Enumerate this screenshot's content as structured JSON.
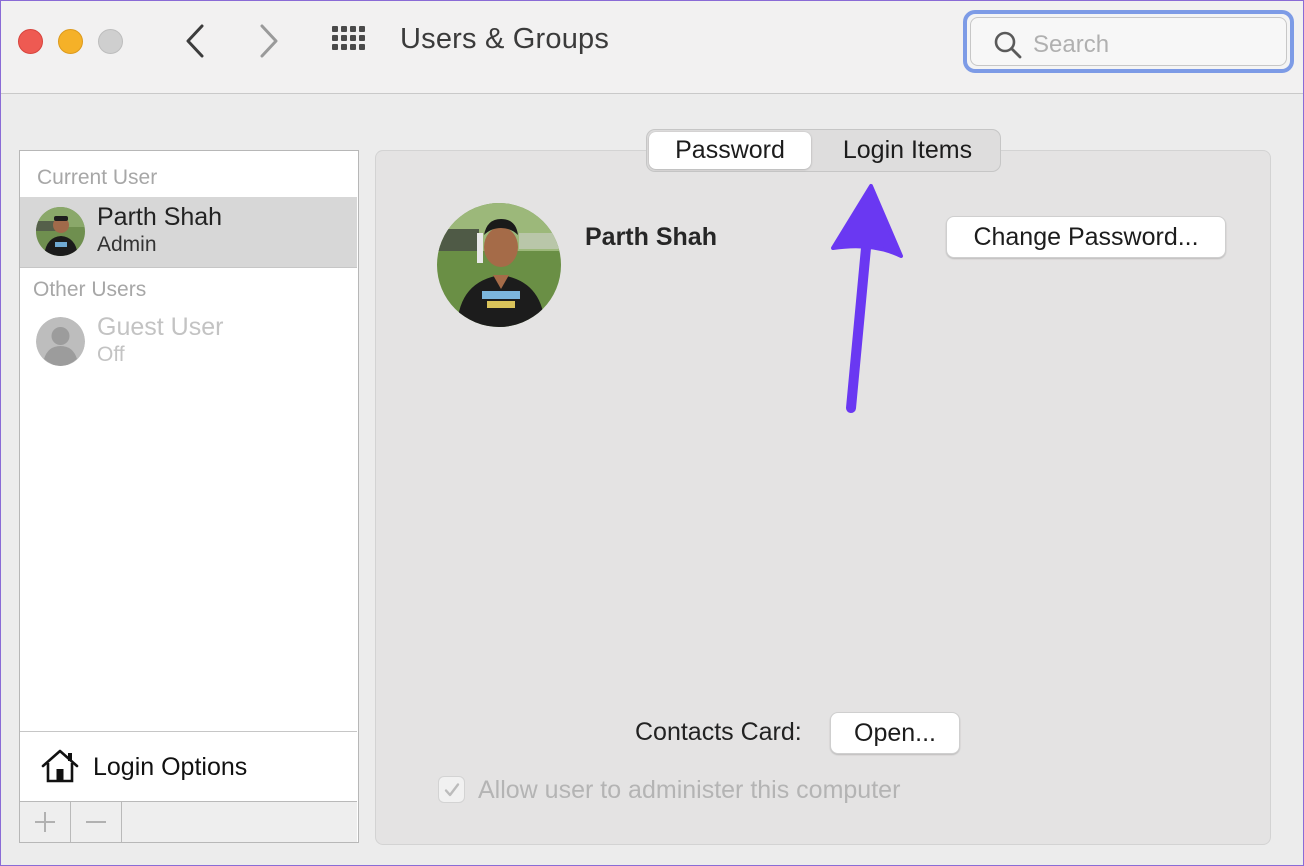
{
  "window": {
    "title": "Users & Groups"
  },
  "search": {
    "placeholder": "Search"
  },
  "sidebar": {
    "current_user_header": "Current User",
    "current_user": {
      "name": "Parth Shah",
      "role": "Admin"
    },
    "other_users_header": "Other Users",
    "other_users": [
      {
        "name": "Guest User",
        "status": "Off"
      }
    ],
    "login_options_label": "Login Options",
    "add_label": "+",
    "remove_label": "−"
  },
  "tabs": {
    "password": "Password",
    "login_items": "Login Items",
    "selected": "Password"
  },
  "main": {
    "user_name": "Parth Shah",
    "change_password_label": "Change Password...",
    "contacts_card_label": "Contacts Card:",
    "open_label": "Open...",
    "admin_checkbox_label": "Allow user to administer this computer",
    "admin_checkbox_checked": true
  },
  "colors": {
    "accent_arrow": "#6a38f2",
    "selected_row": "#d7d7d7",
    "search_focus": "#7d9be6"
  }
}
